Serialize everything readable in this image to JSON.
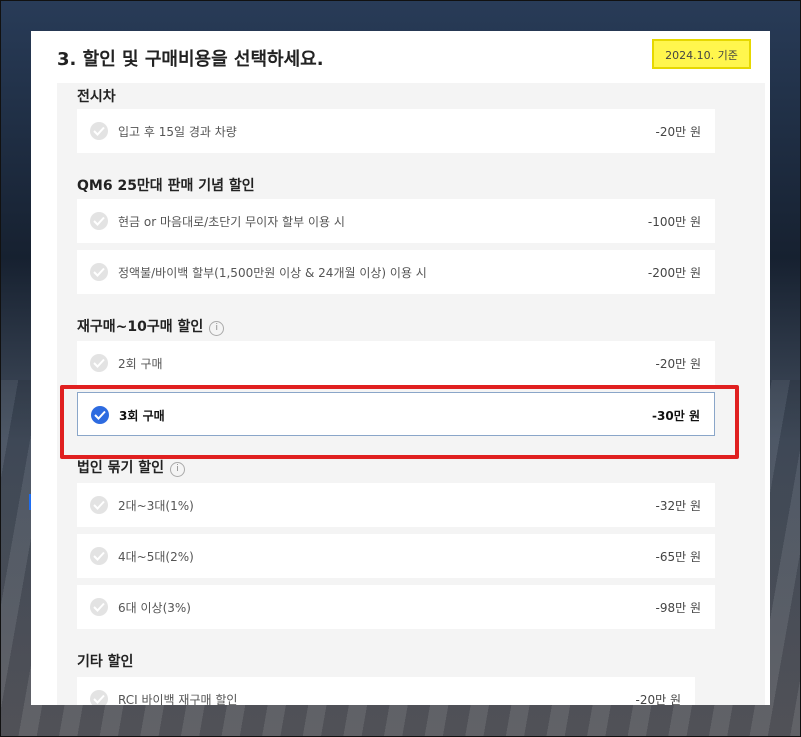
{
  "header": {
    "title": "3. 할인 및 구매비용을 선택하세요.",
    "date_badge": "2024.10. 기준"
  },
  "groups": [
    {
      "title": "전시차",
      "info": false,
      "options": [
        {
          "label": "입고 후 15일 경과 차량",
          "price": "-20만 원",
          "selected": false
        }
      ]
    },
    {
      "title": "QM6 25만대 판매 기념 할인",
      "info": false,
      "options": [
        {
          "label": "현금 or 마음대로/초단기 무이자 할부 이용 시",
          "price": "-100만 원",
          "selected": false
        },
        {
          "label": "정액불/바이백 할부(1,500만원 이상 & 24개월 이상) 이용 시",
          "price": "-200만 원",
          "selected": false
        }
      ]
    },
    {
      "title": "재구매~10구매 할인",
      "info": true,
      "options": [
        {
          "label": "2회 구매",
          "price": "-20만 원",
          "selected": false
        },
        {
          "label": "3회 구매",
          "price": "-30만 원",
          "selected": true
        }
      ]
    },
    {
      "title": "법인 묶기 할인",
      "info": true,
      "options": [
        {
          "label": "2대~3대(1%)",
          "price": "-32만 원",
          "selected": false
        },
        {
          "label": "4대~5대(2%)",
          "price": "-65만 원",
          "selected": false
        },
        {
          "label": "6대 이상(3%)",
          "price": "-98만 원",
          "selected": false
        }
      ]
    },
    {
      "title": "기타 할인",
      "info": false,
      "options": [
        {
          "label": "RCI 바이백 재구매 할인",
          "price": "-20만 원",
          "selected": false
        }
      ]
    }
  ],
  "info_icon_glyph": "i",
  "colors": {
    "accent": "#2d6be0",
    "highlight": "#e02020",
    "badge": "#fff64d"
  }
}
